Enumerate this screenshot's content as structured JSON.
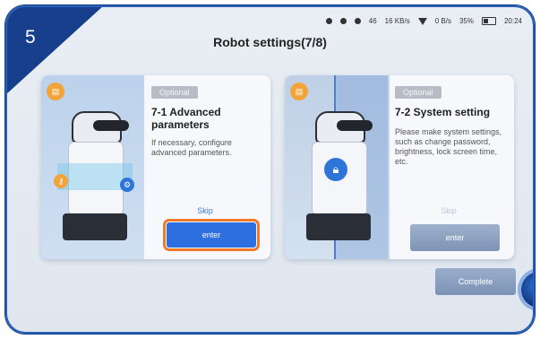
{
  "step": {
    "number": "5"
  },
  "status_bar": {
    "signal": "46",
    "net_speed_1": "16",
    "net_speed_unit_1": "KB/s",
    "net_speed_2": "0",
    "net_speed_unit_2": "B/s",
    "battery": "35%",
    "time": "20:24"
  },
  "page": {
    "title": "Robot settings(7/8)"
  },
  "cards": [
    {
      "tag": "Optional",
      "title": "7-1  Advanced parameters",
      "description": "If necessary, configure advanced parameters.",
      "skip_label": "Skip",
      "enter_label": "enter"
    },
    {
      "tag": "Optional",
      "title": "7-2  System setting",
      "description": "Please make system settings, such as change password, brightness, lock screen time, etc.",
      "skip_label": "Skip",
      "enter_label": "enter"
    }
  ],
  "footer": {
    "complete_label": "Complete"
  },
  "colors": {
    "accent": "#2d6fe0",
    "highlight": "#f07a2b",
    "corner": "#173f8c"
  }
}
